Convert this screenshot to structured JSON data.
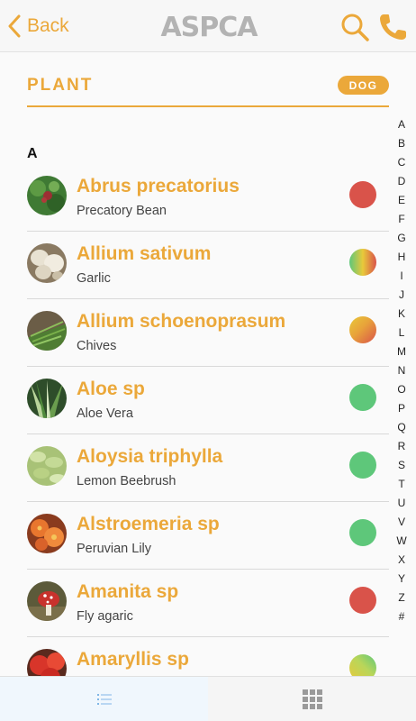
{
  "nav": {
    "back_label": "Back",
    "logo_text": "ASPCA",
    "accent_color": "#eba83a"
  },
  "section": {
    "title": "PLANT",
    "badge": "DOG"
  },
  "group_letter": "A",
  "toxicity_colors": {
    "toxic": "#d9534a",
    "non_toxic": "#5ec77a"
  },
  "plants": [
    {
      "scientific": "Abrus precatorius",
      "common": "Precatory Bean",
      "toxicity": "toxic"
    },
    {
      "scientific": "Allium sativum",
      "common": "Garlic",
      "toxicity": "mixed"
    },
    {
      "scientific": "Allium schoenoprasum",
      "common": "Chives",
      "toxicity": "mixed"
    },
    {
      "scientific": "Aloe sp",
      "common": "Aloe Vera",
      "toxicity": "non-toxic"
    },
    {
      "scientific": "Aloysia triphylla",
      "common": "Lemon Beebrush",
      "toxicity": "non-toxic"
    },
    {
      "scientific": "Alstroemeria sp",
      "common": "Peruvian Lily",
      "toxicity": "non-toxic"
    },
    {
      "scientific": "Amanita sp",
      "common": "Fly agaric",
      "toxicity": "toxic"
    },
    {
      "scientific": "Amaryllis sp",
      "common": "",
      "toxicity": "mixed"
    }
  ],
  "alphabet_index": [
    "A",
    "B",
    "C",
    "D",
    "E",
    "F",
    "G",
    "H",
    "I",
    "J",
    "K",
    "L",
    "M",
    "N",
    "O",
    "P",
    "Q",
    "R",
    "S",
    "T",
    "U",
    "V",
    "W",
    "X",
    "Y",
    "Z",
    "#"
  ],
  "tabs": [
    {
      "name": "list-view",
      "icon": "list-icon",
      "active": true
    },
    {
      "name": "grid-view",
      "icon": "grid-icon",
      "active": false
    }
  ]
}
